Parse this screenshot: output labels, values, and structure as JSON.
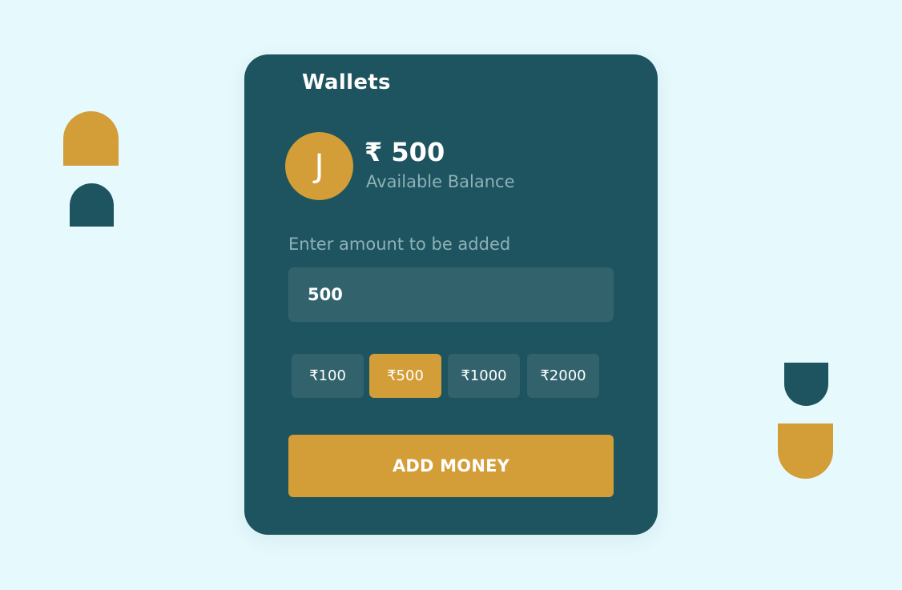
{
  "wallet": {
    "title": "Wallets",
    "avatar_initial": "J",
    "balance": "₹ 500",
    "balance_label": "Available Balance",
    "amount_label": "Enter amount to be added",
    "amount_value": "500",
    "presets": [
      {
        "label": "₹100",
        "selected": false
      },
      {
        "label": "₹500",
        "selected": true
      },
      {
        "label": "₹1000",
        "selected": false
      },
      {
        "label": "₹2000",
        "selected": false
      }
    ],
    "add_button_label": "ADD MONEY"
  },
  "colors": {
    "page_background": "#e6f9fd",
    "card_background": "#1d545f",
    "accent": "#d39d38",
    "input_background": "#32636d",
    "muted_text": "#8fb1b7",
    "text": "#ffffff"
  }
}
